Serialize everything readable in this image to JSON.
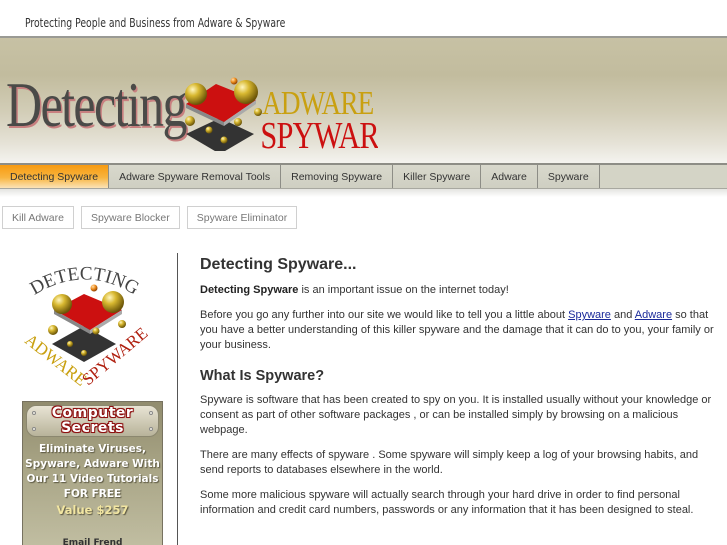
{
  "tagline": "Protecting People and Business from Adware & Spyware",
  "logo": {
    "word_main": "Detecting",
    "word_top": "ADWARE",
    "word_bottom": "SPYWARE"
  },
  "nav": {
    "items": [
      {
        "label": "Detecting Spyware",
        "active": true
      },
      {
        "label": "Adware Spyware Removal Tools",
        "active": false
      },
      {
        "label": "Removing Spyware",
        "active": false
      },
      {
        "label": "Killer Spyware",
        "active": false
      },
      {
        "label": "Adware",
        "active": false
      },
      {
        "label": "Spyware",
        "active": false
      }
    ]
  },
  "subnav": {
    "items": [
      {
        "label": "Kill Adware"
      },
      {
        "label": "Spyware Blocker"
      },
      {
        "label": "Spyware Eliminator"
      }
    ]
  },
  "sidebar": {
    "logo": {
      "top": "DETECTING",
      "left": "ADWARE",
      "right": "SPYWARE"
    },
    "ad": {
      "title_line1": "Computer",
      "title_line2": "Secrets",
      "lines": [
        "Eliminate Viruses,",
        "Spyware, Adware With",
        "Our 11 Video Tutorials",
        "FOR FREE"
      ],
      "value": "Value $257",
      "footer": "Email Frend"
    }
  },
  "content": {
    "title": "Detecting Spyware...",
    "intro_bold": "Detecting Spyware",
    "intro_rest": " is an important issue on the internet today!",
    "p2_before": "Before you go any further into our site we would like to tell you a little about ",
    "p2_link1": "Spyware",
    "p2_mid": " and ",
    "p2_link2": "Adware",
    "p2_after": " so that you have a better understanding of this killer spyware and the damage that it can do to you, your family or your business.",
    "h2": "What Is Spyware?",
    "p3": "Spyware is software that has been created to spy on you. It is installed usually without your knowledge or consent as part of other software packages , or can be installed simply by browsing on a malicious webpage.",
    "p4": "There are many effects of spyware . Some spyware will simply keep a log of your browsing habits, and send reports to databases elsewhere in the world.",
    "p5": "Some more malicious spyware will actually search through your hard drive in order to find personal information and credit card numbers, passwords or any information that it has been designed to steal."
  },
  "colors": {
    "nav_active": "#f79a10",
    "link": "#1a2a9a",
    "logo_red": "#cc1010",
    "logo_gold": "#c9a010"
  }
}
